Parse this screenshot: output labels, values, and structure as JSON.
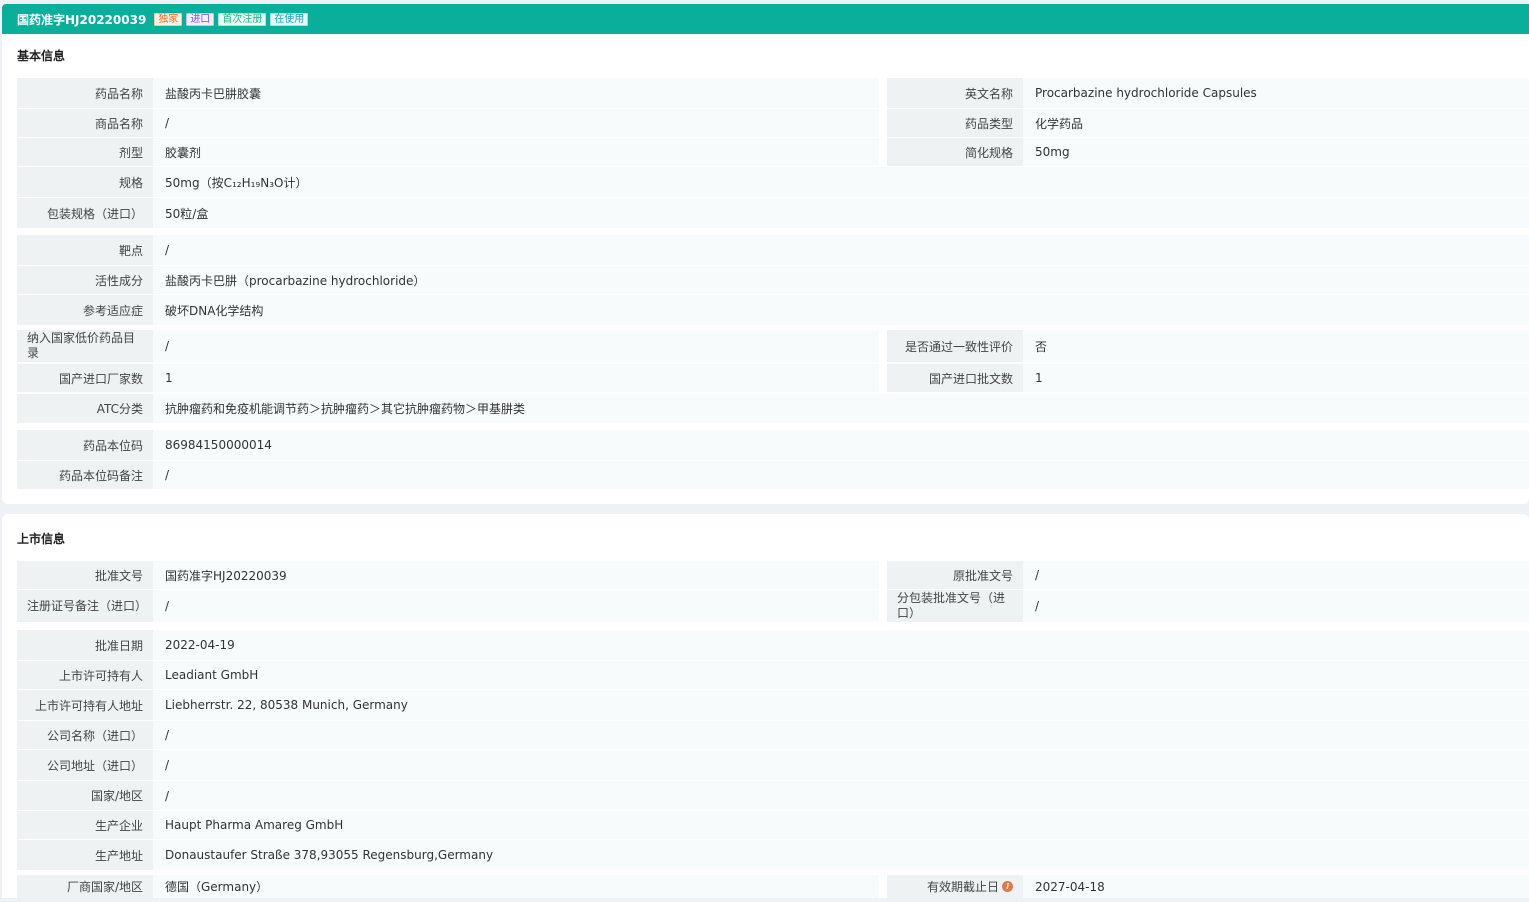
{
  "header": {
    "title": "国药准字HJ20220039",
    "badges": [
      "独家",
      "进口",
      "首次注册",
      "在使用"
    ]
  },
  "basic": {
    "section_title": "基本信息",
    "drug_name_label": "药品名称",
    "drug_name": "盐酸丙卡巴肼胶囊",
    "en_name_label": "英文名称",
    "en_name": "Procarbazine hydrochloride Capsules",
    "trade_name_label": "商品名称",
    "trade_name": "/",
    "drug_type_label": "药品类型",
    "drug_type": "化学药品",
    "dosage_form_label": "剂型",
    "dosage_form": "胶囊剂",
    "simple_spec_label": "简化规格",
    "simple_spec": "50mg",
    "spec_label": "规格",
    "spec": "50mg（按C₁₂H₁₉N₃O计）",
    "package_label": "包装规格（进口）",
    "package": "50粒/盒",
    "target_label": "靶点",
    "target": "/",
    "active_label": "活性成分",
    "active": "盐酸丙卡巴肼（procarbazine hydrochloride）",
    "indication_label": "参考适应症",
    "indication": "破坏DNA化学结构",
    "low_price_label": "纳入国家低价药品目录",
    "low_price": "/",
    "consistency_label": "是否通过一致性评价",
    "consistency": "否",
    "makers_label": "国产进口厂家数",
    "makers": "1",
    "approvals_label": "国产进口批文数",
    "approvals": "1",
    "atc_label": "ATC分类",
    "atc": "抗肿瘤药和免疫机能调节药＞抗肿瘤药＞其它抗肿瘤药物＞甲基肼类",
    "code_label": "药品本位码",
    "code": "86984150000014",
    "code_note_label": "药品本位码备注",
    "code_note": "/"
  },
  "market": {
    "section_title": "上市信息",
    "approval_no_label": "批准文号",
    "approval_no": "国药准字HJ20220039",
    "orig_approval_label": "原批准文号",
    "orig_approval": "/",
    "reg_note_label": "注册证号备注（进口）",
    "reg_note": "/",
    "sub_pkg_label": "分包装批准文号（进口）",
    "sub_pkg": "/",
    "approval_date_label": "批准日期",
    "approval_date": "2022-04-19",
    "holder_label": "上市许可持有人",
    "holder": "Leadiant GmbH",
    "holder_addr_label": "上市许可持有人地址",
    "holder_addr": "Liebherrstr. 22, 80538 Munich, Germany",
    "company_label": "公司名称（进口）",
    "company": "/",
    "company_addr_label": "公司地址（进口）",
    "company_addr": "/",
    "country_label": "国家/地区",
    "country": "/",
    "producer_label": "生产企业",
    "producer": "Haupt Pharma Amareg GmbH",
    "producer_addr_label": "生产地址",
    "producer_addr": "Donaustaufer Straße 378,93055 Regensburg,Germany",
    "vendor_country_label": "厂商国家/地区",
    "vendor_country": "德国（Germany）",
    "expiry_label": "有效期截止日",
    "expiry": "2027-04-18",
    "info_icon_glyph": "i"
  }
}
